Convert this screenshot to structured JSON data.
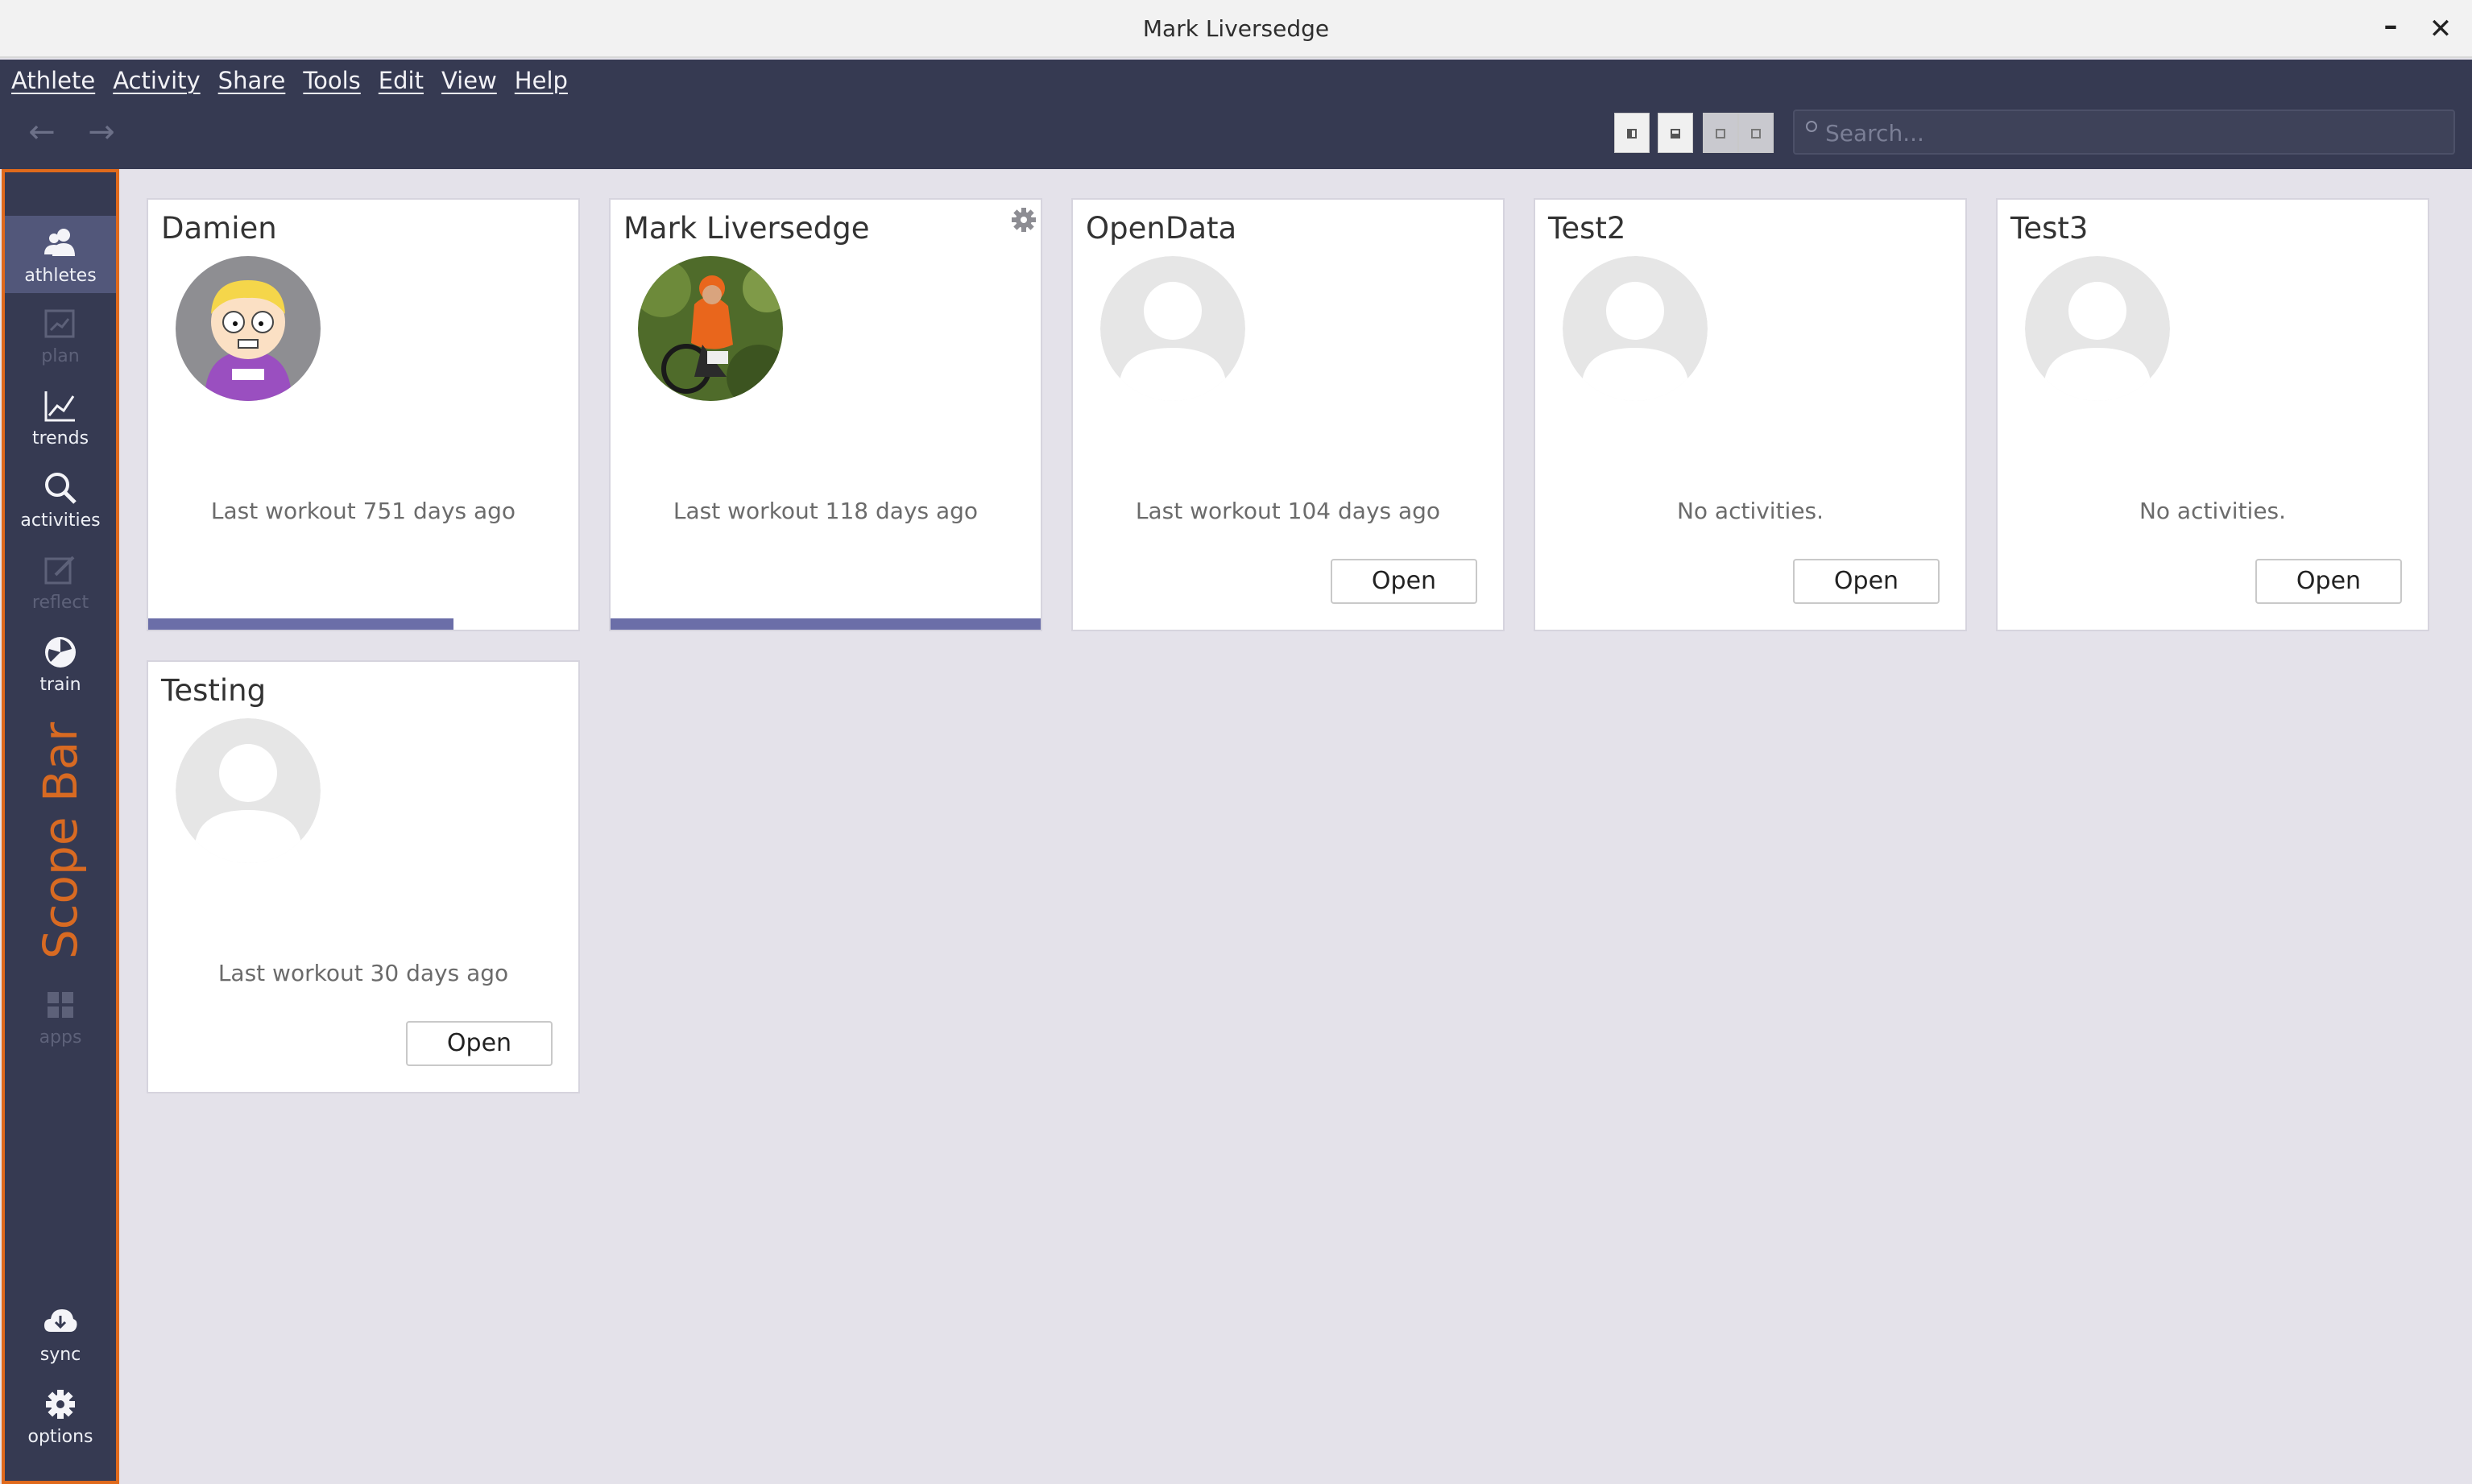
{
  "window": {
    "title": "Mark Liversedge",
    "minimize": "–",
    "close": "✕"
  },
  "menu": [
    "Athlete",
    "Activity",
    "Share",
    "Tools",
    "Edit",
    "View",
    "Help"
  ],
  "toolbar": {
    "back": "←",
    "forward": "→",
    "search_placeholder": "Search..."
  },
  "scopebar": {
    "title": "Scope Bar",
    "items": [
      {
        "label": "athletes",
        "icon": "athletes-icon",
        "active": true
      },
      {
        "label": "plan",
        "icon": "plan-icon",
        "disabled": true
      },
      {
        "label": "trends",
        "icon": "trends-icon"
      },
      {
        "label": "activities",
        "icon": "activities-icon"
      },
      {
        "label": "reflect",
        "icon": "reflect-icon",
        "disabled": true
      },
      {
        "label": "train",
        "icon": "train-icon"
      },
      {
        "label": "apps",
        "icon": "apps-icon",
        "disabled": true
      },
      {
        "label": "sync",
        "icon": "sync-icon"
      },
      {
        "label": "options",
        "icon": "options-icon"
      }
    ]
  },
  "athletes": [
    {
      "name": "Damien",
      "status": "Last workout 751 days ago",
      "avatar": "cartoon-avatar",
      "progress": 0.71
    },
    {
      "name": "Mark Liversedge",
      "status": "Last workout 118 days ago",
      "avatar": "cyclist-photo",
      "progress": 1.0,
      "settings_icon": "gear-icon"
    },
    {
      "name": "OpenData",
      "status": "Last workout 104 days ago",
      "avatar": "default-avatar",
      "open_label": "Open"
    },
    {
      "name": "Test2",
      "status": "No activities.",
      "avatar": "default-avatar",
      "open_label": "Open"
    },
    {
      "name": "Test3",
      "status": "No activities.",
      "avatar": "default-avatar",
      "open_label": "Open"
    },
    {
      "name": "Testing",
      "status": "Last workout 30 days ago",
      "avatar": "default-avatar",
      "open_label": "Open"
    }
  ],
  "colors": {
    "toolbar_bg": "#363a52",
    "accent": "#6b6ea8",
    "scope_highlight": "#e06a1c",
    "content_bg": "#e4e2ea"
  }
}
